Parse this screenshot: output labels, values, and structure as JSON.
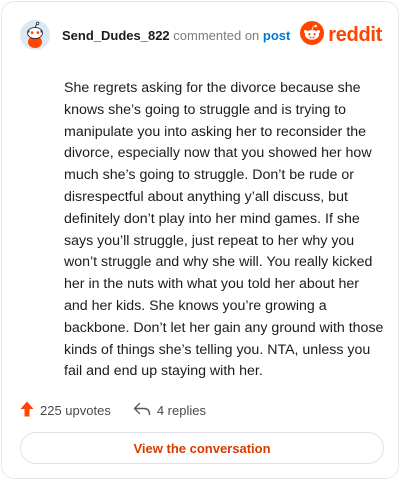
{
  "header": {
    "username": "Send_Dudes_822",
    "action_text": "commented on",
    "post_link": "post",
    "brand": "reddit"
  },
  "comment": {
    "body": "She regrets asking for the divorce because she knows she’s going to struggle and is trying to manipulate you into asking her to reconsider the divorce, especially now that you showed her how much she’s going to struggle. Don’t be rude or disrespectful about anything y’all discuss, but definitely don’t play into her mind games. If she says you’ll struggle, just repeat to her why you won’t struggle and why she will. You really kicked her in the nuts with what you told her about her and her kids. She knows you’re growing a backbone. Don’t let her gain any ground with those kinds of things she’s telling you. NTA, unless you fail and end up staying with her."
  },
  "stats": {
    "upvotes": "225 upvotes",
    "replies": "4 replies"
  },
  "footer": {
    "view_button": "View the conversation"
  },
  "icons": {
    "avatar": "snoo-avatar-icon",
    "brand": "reddit-snoo-icon",
    "upvote": "upvote-arrow-icon",
    "reply": "reply-arrow-icon"
  },
  "colors": {
    "brand": "#ff4500",
    "link": "#0079d3",
    "button_text": "#d93a00",
    "upvote": "#ff4500"
  }
}
